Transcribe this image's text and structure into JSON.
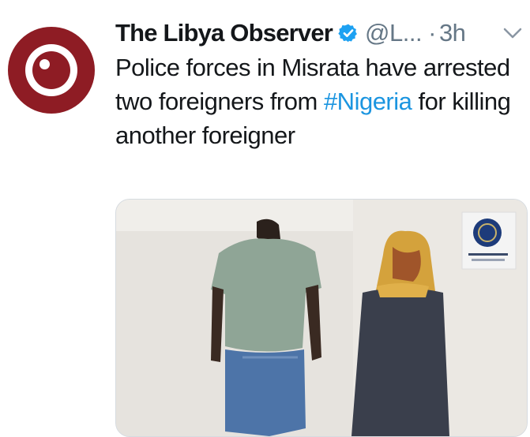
{
  "tweet": {
    "author_name": "The Libya Observer",
    "handle": "@L...",
    "separator": "·",
    "time": "3h",
    "text_before": "Police forces in Misrata have arrested two foreigners from ",
    "hashtag": "#Nigeria",
    "text_after": " for killing another foreigner"
  },
  "icons": {
    "avatar": "libya-observer-logo",
    "verified": "verified-badge-icon",
    "menu": "chevron-down-icon",
    "watermark": "police-emblem"
  },
  "colors": {
    "brand": "#8e1c24",
    "link": "#1b95e0",
    "muted": "#657786",
    "text": "#14171a",
    "verified": "#1da1f2"
  }
}
